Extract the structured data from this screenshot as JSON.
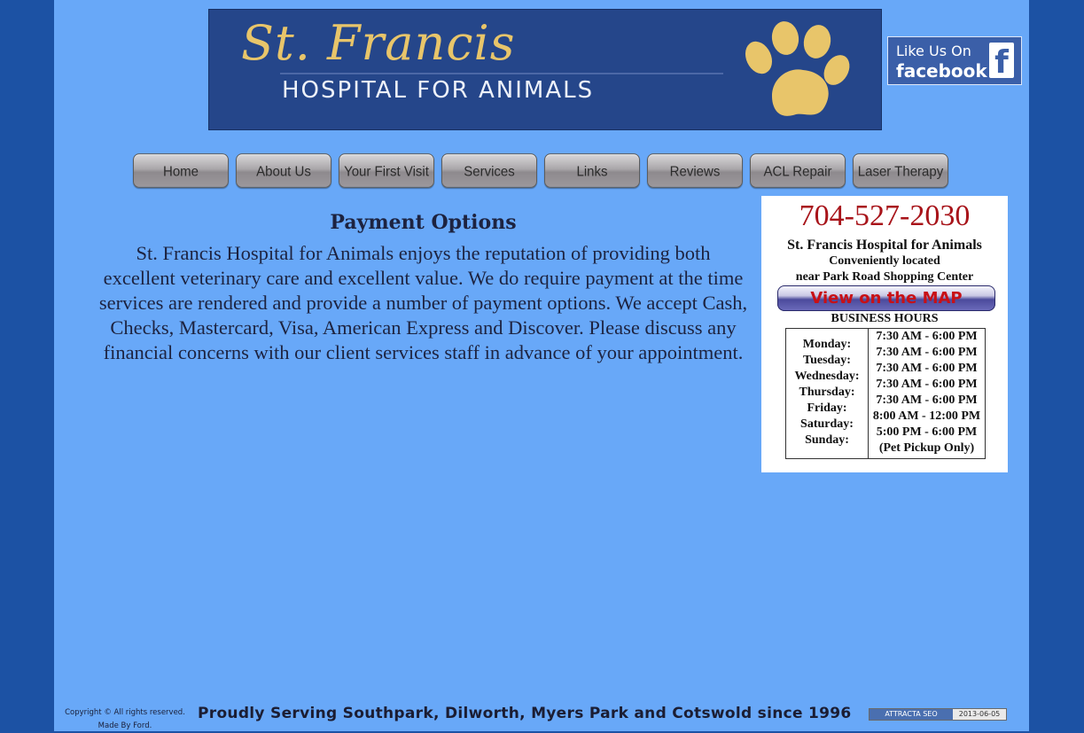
{
  "banner": {
    "title": "St. Francis",
    "subtitle": "HOSPITAL FOR ANIMALS",
    "icon": "paw-icon"
  },
  "facebook": {
    "line1": "Like Us On",
    "line2": "facebook",
    "glyph": "f",
    "icon": "facebook-icon"
  },
  "nav": {
    "items": [
      {
        "label": "Home"
      },
      {
        "label": "About Us"
      },
      {
        "label": "Your First Visit"
      },
      {
        "label": "Services"
      },
      {
        "label": "Links"
      },
      {
        "label": "Reviews"
      },
      {
        "label": "ACL Repair"
      },
      {
        "label": "Laser Therapy"
      }
    ]
  },
  "content": {
    "title": "Payment Options",
    "body": "St. Francis Hospital for Animals  enjoys the reputation of providing both excellent veterinary care and excellent value. We do require payment at the time services are rendered and provide a number of payment options. We accept Cash, Checks, Mastercard, Visa, American Express and Discover. Please discuss any financial concerns with our client services staff in advance of your appointment."
  },
  "card": {
    "phone": "704-527-2030",
    "name": "St. Francis Hospital for Animals",
    "location_line1": "Conveniently located",
    "location_line2": "near Park Road Shopping Center",
    "map_button": "View on the MAP",
    "hours_title": "BUSINESS HOURS",
    "hours": [
      {
        "day": "Monday:",
        "time": "7:30 AM - 6:00 PM"
      },
      {
        "day": "Tuesday:",
        "time": "7:30 AM - 6:00 PM"
      },
      {
        "day": "Wednesday:",
        "time": "7:30 AM - 6:00 PM"
      },
      {
        "day": "Thursday:",
        "time": "7:30 AM - 6:00 PM"
      },
      {
        "day": "Friday:",
        "time": "7:30 AM - 6:00 PM"
      },
      {
        "day": "Saturday:",
        "time": "8:00 AM - 12:00 PM"
      },
      {
        "day": "Sunday:",
        "time": "5:00 PM - 6:00 PM"
      },
      {
        "day": "",
        "time": "(Pet Pickup Only)"
      }
    ]
  },
  "footer": {
    "copyright": "Copyright © All rights reserved.",
    "made_by": "Made By Ford.",
    "tagline": "Proudly Serving Southpark, Dilworth, Myers Park and Cotswold since 1996",
    "badge_left": "ATTRACTA SEO",
    "badge_right": "2013-06-05"
  },
  "colors": {
    "outer_background": "#1c52a4",
    "page_background": "#68a8f8",
    "banner_background": "#25468a",
    "banner_gold": "#e8c56a",
    "phone_red": "#a8141a",
    "facebook_blue": "#3b5fa8"
  }
}
